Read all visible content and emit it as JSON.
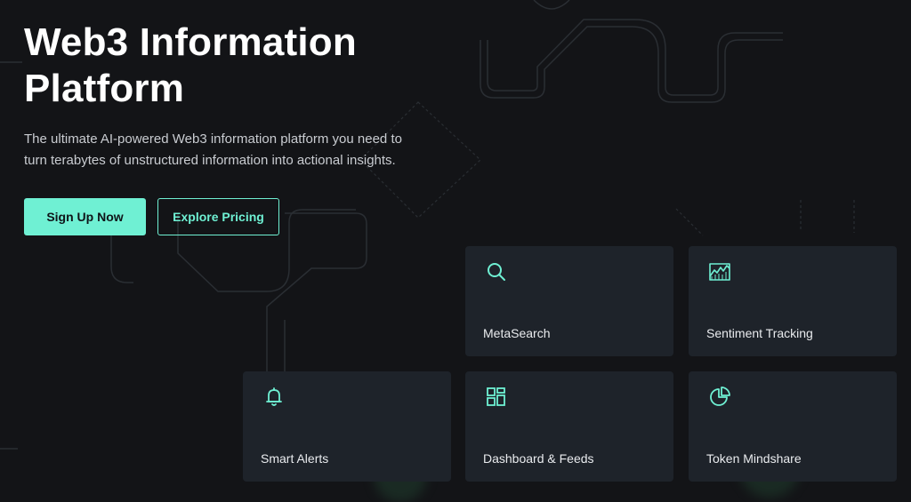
{
  "hero": {
    "title": "Web3 Information Platform",
    "subtitle": "The ultimate AI-powered Web3 information platform you need to turn terabytes of unstructured information into actional insights."
  },
  "actions": {
    "primary_label": "Sign Up Now",
    "secondary_label": "Explore Pricing"
  },
  "features": {
    "metasearch": {
      "label": "MetaSearch",
      "icon": "search-icon"
    },
    "sentiment": {
      "label": "Sentiment Tracking",
      "icon": "trend-chart-icon"
    },
    "alerts": {
      "label": "Smart Alerts",
      "icon": "bell-icon"
    },
    "dashboard": {
      "label": "Dashboard & Feeds",
      "icon": "grid-icon"
    },
    "mindshare": {
      "label": "Token Mindshare",
      "icon": "pie-chart-icon"
    }
  },
  "colors": {
    "background": "#131417",
    "accent": "#6ff0d3",
    "card": "#1e232a"
  }
}
